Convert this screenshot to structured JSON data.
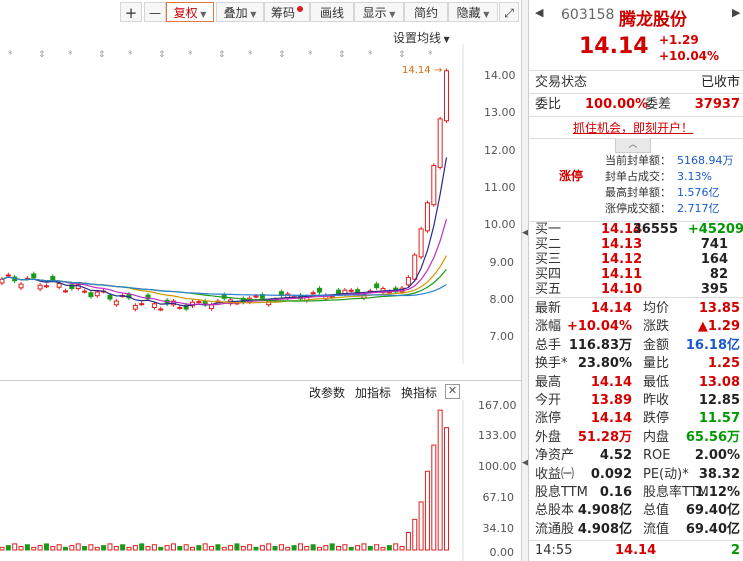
{
  "toolbar": {
    "plus": "+",
    "minus": "—",
    "fuquan": "复权",
    "diejia": "叠加",
    "chouma": "筹码",
    "huaxian": "画线",
    "xianshi": "显示",
    "jianyue": "简约",
    "yincang": "隐藏"
  },
  "kline": {
    "settings_label": "设置均线",
    "price_marker": "14.14",
    "y_ticks": [
      "14.00",
      "13.00",
      "12.00",
      "11.00",
      "10.00",
      "9.00",
      "8.00",
      "7.00"
    ],
    "colors": {
      "up": "#e02020",
      "down": "#1a9a1a",
      "ma5": "#2a2a8c",
      "ma10": "#c030c0",
      "ma20": "#cc9900",
      "ma30": "#1a9a1a",
      "ma60": "#2e7fd0"
    }
  },
  "volume": {
    "buttons": [
      "改参数",
      "加指标",
      "换指标"
    ],
    "y_ticks": [
      "167.00",
      "133.00",
      "100.00",
      "67.10",
      "34.10",
      "0.00"
    ]
  },
  "panel": {
    "code": "603158",
    "name": "腾龙股份",
    "price": "14.14",
    "change": "+1.29",
    "change_pct": "+10.04%",
    "status_label": "交易状态",
    "status_value": "已收市",
    "weibi_label": "委比",
    "weibi_value": "100.00%",
    "weicha_label": "委差",
    "weicha_value": "37937",
    "promo": "抓住机会，即刻开户！",
    "limit_tag": "涨停",
    "seal": [
      {
        "label": "当前封单额：",
        "value": "5168.94万"
      },
      {
        "label": "封单占成交：",
        "value": "3.13%"
      },
      {
        "label": "最高封单额：",
        "value": "1.576亿"
      },
      {
        "label": "涨停成交额：",
        "value": "2.717亿"
      }
    ],
    "bids": [
      {
        "label": "买一",
        "price": "14.14",
        "vol": "36555",
        "extra": "+45209"
      },
      {
        "label": "买二",
        "price": "14.13",
        "vol": "741",
        "extra": ""
      },
      {
        "label": "买三",
        "price": "14.12",
        "vol": "164",
        "extra": ""
      },
      {
        "label": "买四",
        "price": "14.11",
        "vol": "82",
        "extra": ""
      },
      {
        "label": "买五",
        "price": "14.10",
        "vol": "395",
        "extra": ""
      }
    ],
    "stats": [
      {
        "l1": "最新",
        "v1": "14.14",
        "c1": "red",
        "l2": "均价",
        "v2": "13.85",
        "c2": "red"
      },
      {
        "l1": "涨幅",
        "v1": "+10.04%",
        "c1": "red",
        "l2": "涨跌",
        "v2": "▲1.29",
        "c2": "red"
      },
      {
        "l1": "总手",
        "v1": "116.83万",
        "c1": "",
        "l2": "金额",
        "v2": "16.18亿",
        "c2": "blue"
      },
      {
        "l1": "换手*",
        "v1": "23.80%",
        "c1": "",
        "l2": "量比",
        "v2": "1.25",
        "c2": "red"
      },
      {
        "l1": "最高",
        "v1": "14.14",
        "c1": "red",
        "l2": "最低",
        "v2": "13.08",
        "c2": "red"
      },
      {
        "l1": "今开",
        "v1": "13.89",
        "c1": "red",
        "l2": "昨收",
        "v2": "12.85",
        "c2": ""
      },
      {
        "l1": "涨停",
        "v1": "14.14",
        "c1": "red",
        "l2": "跌停",
        "v2": "11.57",
        "c2": "green"
      },
      {
        "l1": "外盘",
        "v1": "51.28万",
        "c1": "red",
        "l2": "内盘",
        "v2": "65.56万",
        "c2": "green"
      },
      {
        "l1": "净资产",
        "v1": "4.52",
        "c1": "",
        "l2": "ROE",
        "v2": "2.00%",
        "c2": ""
      },
      {
        "l1": "收益㈠",
        "v1": "0.092",
        "c1": "",
        "l2": "PE(动)*",
        "v2": "38.32",
        "c2": ""
      },
      {
        "l1": "股息TTM",
        "v1": "0.16",
        "c1": "",
        "l2": "股息率TTM",
        "v2": "1.12%",
        "c2": ""
      },
      {
        "l1": "总股本",
        "v1": "4.908亿",
        "c1": "",
        "l2": "总值",
        "v2": "69.40亿",
        "c2": ""
      },
      {
        "l1": "流通股",
        "v1": "4.908亿",
        "c1": "",
        "l2": "流值",
        "v2": "69.40亿",
        "c2": ""
      }
    ],
    "tick_time": "14:55",
    "tick_price": "14.14",
    "tick_vol": "2"
  }
}
